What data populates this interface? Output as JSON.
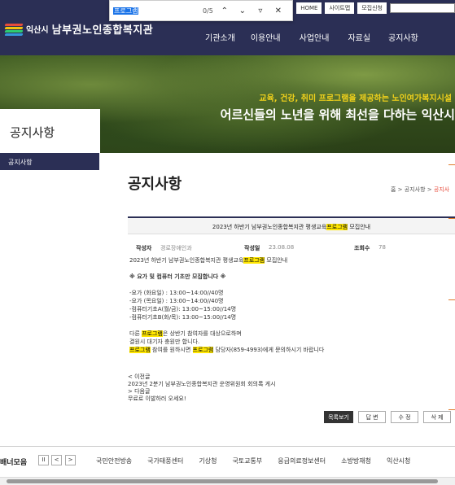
{
  "header": {
    "util": [
      "HOME",
      "사이트맵",
      "모집신청"
    ],
    "logo_city": "익산시",
    "logo_name": "남부권노인종합복지관",
    "menu": [
      "기관소개",
      "이용안내",
      "사업안내",
      "자료실",
      "공지사항"
    ]
  },
  "findbar": {
    "query": "프로그램",
    "count": "0/5"
  },
  "hero": {
    "tagline": "교육, 건강, 취미 프로그램을 제공하는 노인여가복지시설",
    "headline": "어르신들의 노년을 위해 최선을 다하는 익산시"
  },
  "sidebar": {
    "heading": "공지사항",
    "items": [
      "공지사항"
    ]
  },
  "page": {
    "title": "공지사항",
    "breadcrumb": {
      "home": "홈",
      "sep1": " > ",
      "parent": "공지사항",
      "sep2": " > ",
      "current": "공지사"
    }
  },
  "post": {
    "title_pre": "2023년 하반기 남부권노인종합복지관 평생교육",
    "title_hl": "프로그램",
    "title_post": " 모집안내",
    "author_label": "작성자",
    "author": "경로장애인과",
    "date_label": "작성일",
    "date": "23.08.08",
    "views_label": "조회수",
    "views": "78",
    "body": {
      "line1_pre": "2023년 하반기 남부권노인종합복지관 평생교육",
      "line1_hl": "프로그램",
      "line1_post": " 모집안내",
      "line2": "※ 요가 및 컴퓨터 기초만 모집합니다 ※",
      "lines": [
        "-요가 (화요일) : 13:00~14:00//40명",
        "-요가 (목요일) : 13:00~14:00//40명",
        "-컴퓨터기초A(월/금): 13:00~15:00//14명",
        "-컴퓨터기초B(화/목): 13:00~15:00//14명"
      ],
      "n1_pre": "다른 ",
      "n1_hl": "프로그램",
      "n1_post": "은 상반기 참여자를 대상으로하며",
      "n2": "결원시 대기자 충원만 합니다.",
      "n3_hl1": "프로그램",
      "n3_mid": " 참여를 원하시면 ",
      "n3_hl2": "프로그램",
      "n3_post": " 담당자(859-4993)에게 문의하시기 바랍니다"
    }
  },
  "nav": {
    "prev_label": "< 이전글",
    "prev_title": "2023년 2분기 남부권노인종합복지관 운영위원회 회의록 게시",
    "next_label": "> 다음글",
    "next_title": "무료로 이발하러 오세요!"
  },
  "actions": [
    "목록보기",
    "답 변",
    "수 정",
    "삭 제"
  ],
  "banners": {
    "label": "배너모음",
    "controls": [
      "II",
      "<",
      ">"
    ],
    "links": [
      "국민안전방송",
      "국가태풍센터",
      "기상청",
      "국토교통부",
      "응급의료정보센터",
      "소방방재청",
      "익산시청"
    ]
  }
}
